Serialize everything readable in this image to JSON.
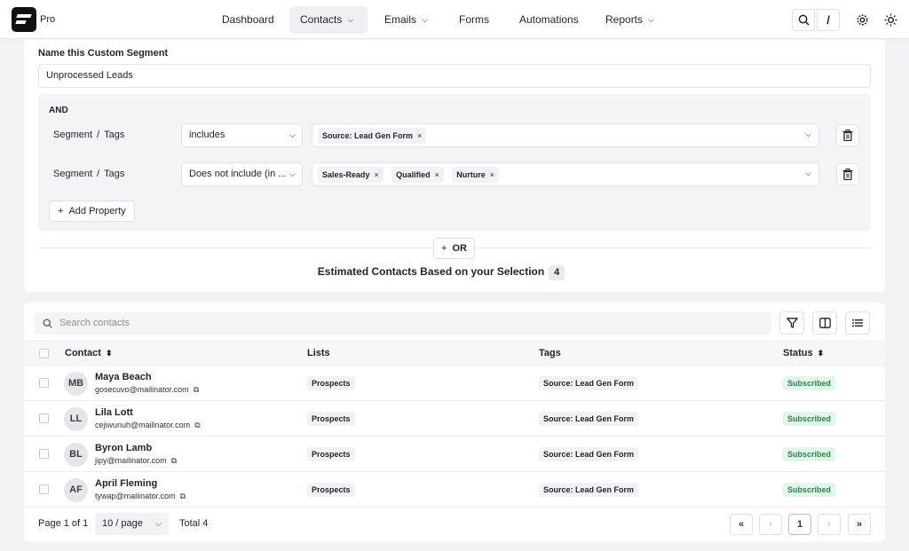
{
  "app": {
    "brand_suffix": "Pro"
  },
  "nav": {
    "items": [
      {
        "label": "Dashboard",
        "dropdown": false
      },
      {
        "label": "Contacts",
        "dropdown": true,
        "active": true
      },
      {
        "label": "Emails",
        "dropdown": true
      },
      {
        "label": "Forms",
        "dropdown": false
      },
      {
        "label": "Automations",
        "dropdown": false
      },
      {
        "label": "Reports",
        "dropdown": true
      }
    ],
    "shortcut_key": "/"
  },
  "segment": {
    "name_label": "Name this Custom Segment",
    "name_value": "Unprocessed Leads",
    "group_operator": "AND",
    "rules": [
      {
        "field_a": "Segment",
        "field_b": "Tags",
        "operator": "includes",
        "values": [
          "Source: Lead Gen Form"
        ]
      },
      {
        "field_a": "Segment",
        "field_b": "Tags",
        "operator": "Does not include (in ...",
        "values": [
          "Sales-Ready",
          "Qualified",
          "Nurture"
        ]
      }
    ],
    "add_property_label": "Add Property",
    "or_label": "OR",
    "estimate_label": "Estimated Contacts Based on your Selection",
    "estimate_count": "4"
  },
  "contacts": {
    "search_placeholder": "Search contacts",
    "columns": {
      "contact": "Contact",
      "lists": "Lists",
      "tags": "Tags",
      "status": "Status"
    },
    "rows": [
      {
        "initials": "MB",
        "name": "Maya Beach",
        "email": "gosecuvo@mailinator.com",
        "list": "Prospects",
        "tag": "Source: Lead Gen Form",
        "status": "Subscribed"
      },
      {
        "initials": "LL",
        "name": "Lila Lott",
        "email": "cejiwunuh@mailinator.com",
        "list": "Prospects",
        "tag": "Source: Lead Gen Form",
        "status": "Subscribed"
      },
      {
        "initials": "BL",
        "name": "Byron Lamb",
        "email": "jipy@mailinator.com",
        "list": "Prospects",
        "tag": "Source: Lead Gen Form",
        "status": "Subscribed"
      },
      {
        "initials": "AF",
        "name": "April Fleming",
        "email": "tywap@mailinator.com",
        "list": "Prospects",
        "tag": "Source: Lead Gen Form",
        "status": "Subscribed"
      }
    ],
    "pagination": {
      "page_text": "Page 1 of 1",
      "per_page": "10 / page",
      "total_text": "Total 4",
      "current_page": "1"
    }
  },
  "colors": {
    "status_green_bg": "#e3f6ea",
    "status_green_text": "#1f8a4c",
    "accent_dark": "#111111"
  }
}
